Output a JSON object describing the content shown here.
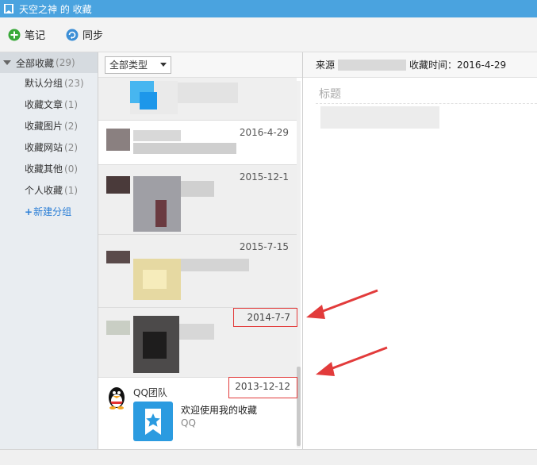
{
  "window": {
    "title": "天空之神 的 收藏"
  },
  "toolbar": {
    "note_label": "笔记",
    "sync_label": "同步"
  },
  "sidebar": {
    "root": {
      "label": "全部收藏",
      "count": "(29)"
    },
    "items": [
      {
        "label": "默认分组",
        "count": "(23)"
      },
      {
        "label": "收藏文章",
        "count": "(1)"
      },
      {
        "label": "收藏图片",
        "count": "(2)"
      },
      {
        "label": "收藏网站",
        "count": "(2)"
      },
      {
        "label": "收藏其他",
        "count": "(0)"
      },
      {
        "label": "个人收藏",
        "count": "(1)"
      }
    ],
    "new_group": "新建分组"
  },
  "list": {
    "filter_selected": "全部类型",
    "items": [
      {
        "date": ""
      },
      {
        "date": "2016-4-29"
      },
      {
        "date": "2015-12-1"
      },
      {
        "date": "2015-7-15"
      },
      {
        "date": "2014-7-7"
      },
      {
        "date": "2013-12-12",
        "sender": "QQ团队",
        "message": "欢迎使用我的收藏",
        "sub": "QQ"
      }
    ]
  },
  "detail": {
    "source_label": "来源",
    "time_label": "收藏时间：2016-4-29",
    "title_placeholder": "标题"
  },
  "colors": {
    "titlebar": "#4aa3df",
    "highlight_box": "#e23b3b",
    "arrow": "#e23b3b",
    "link": "#2a7ed6"
  }
}
